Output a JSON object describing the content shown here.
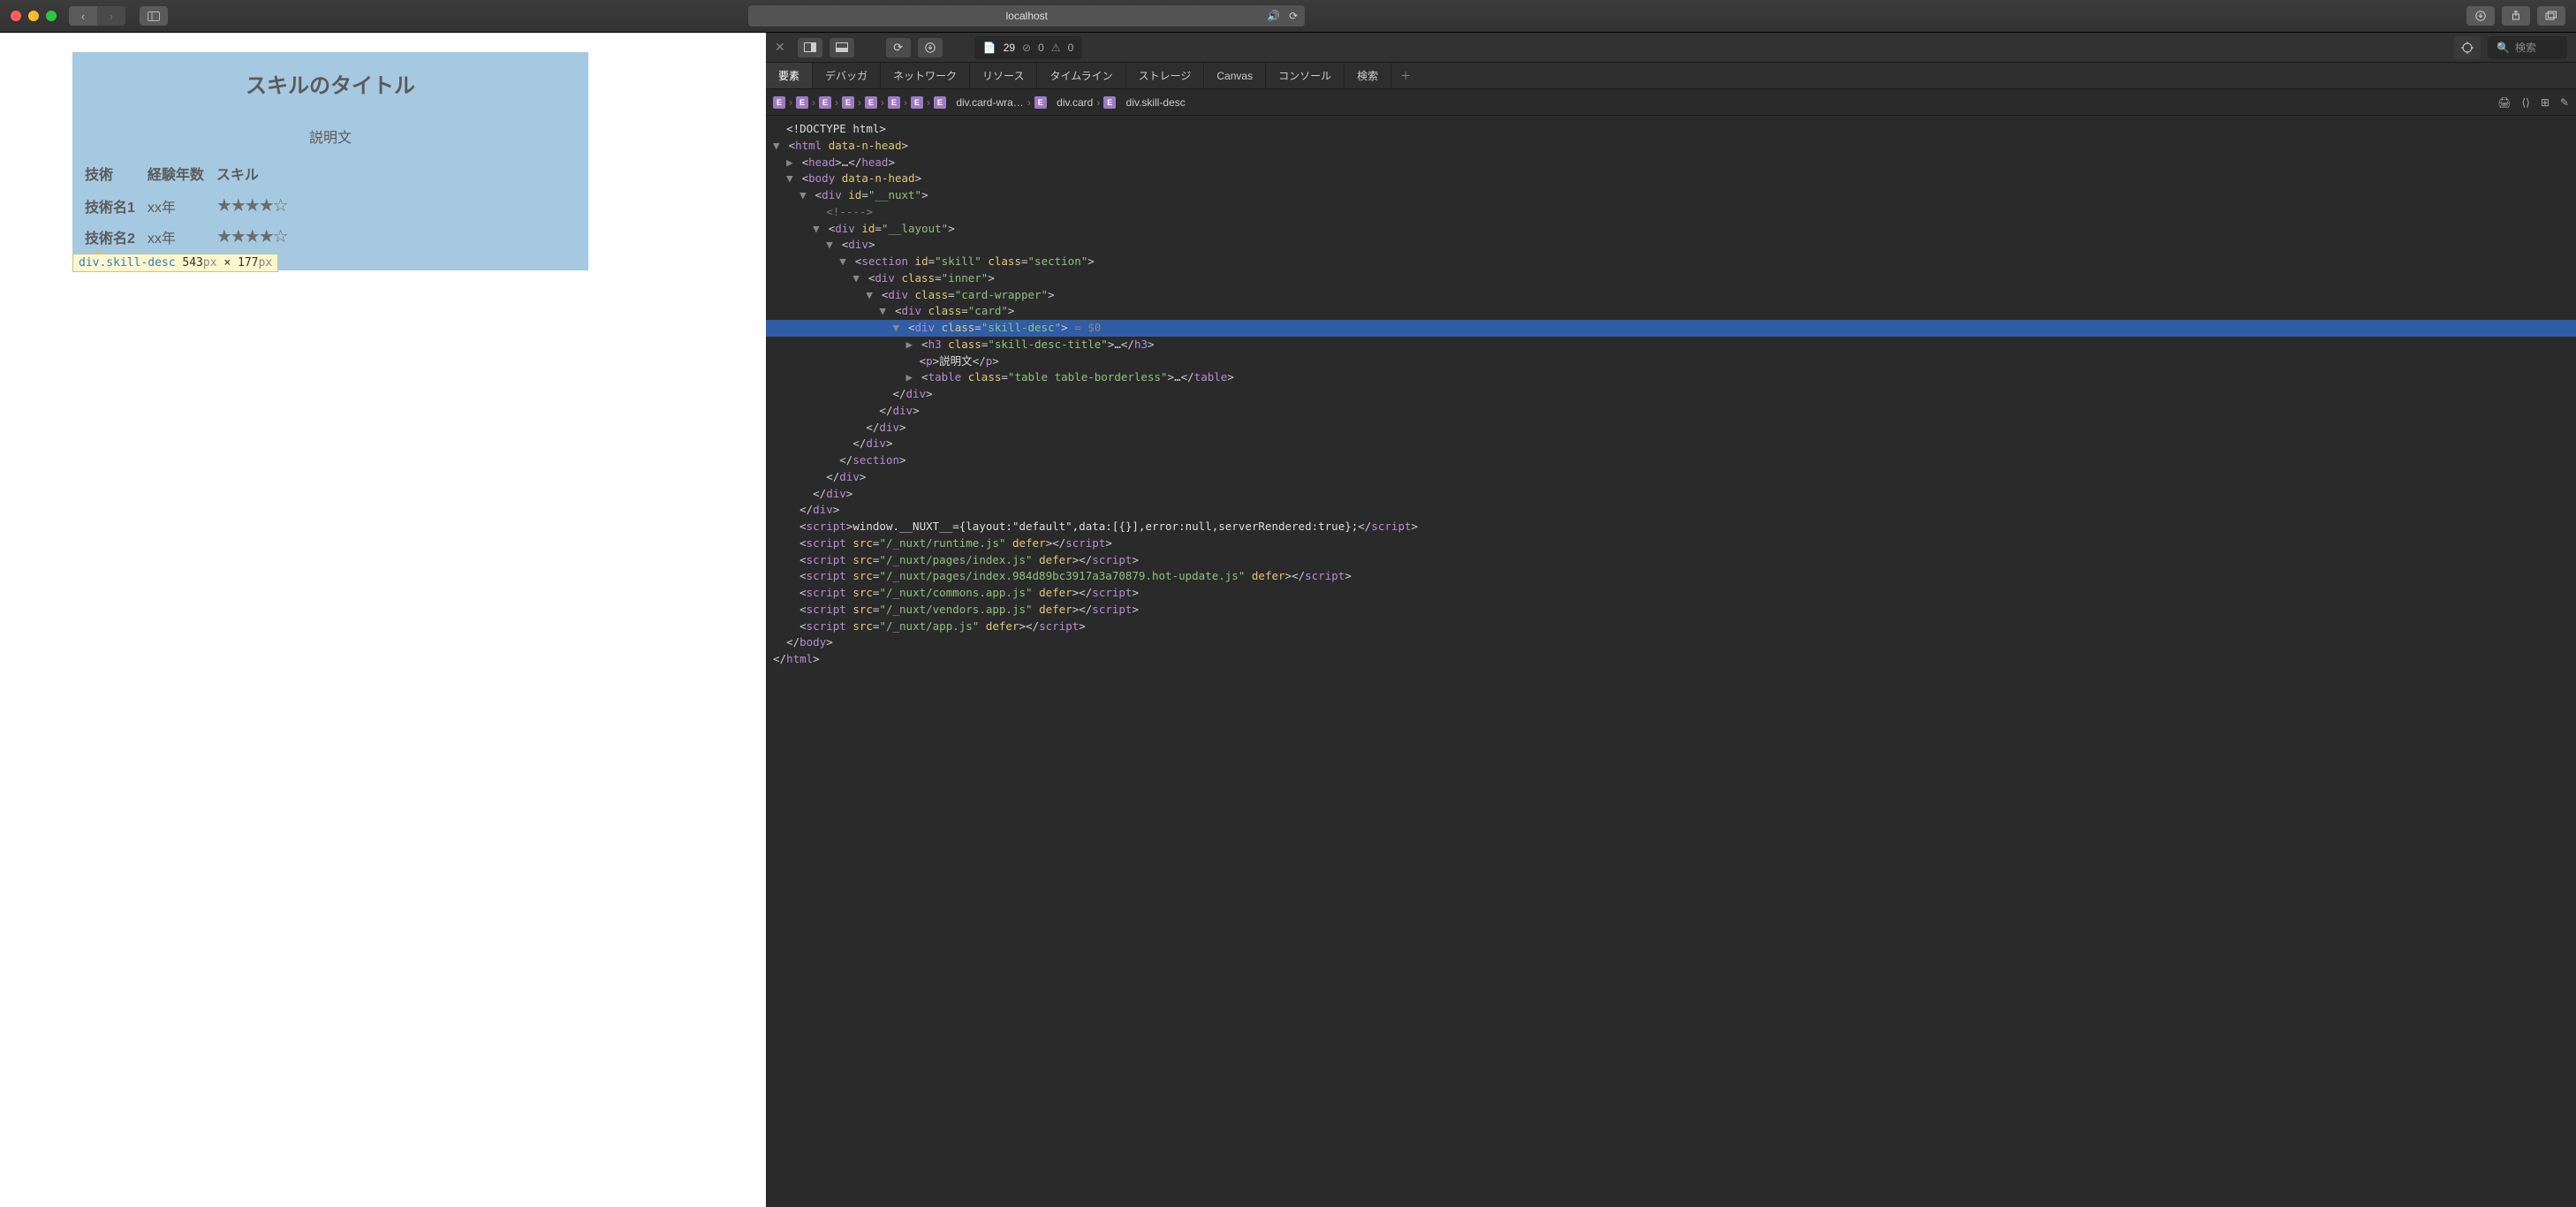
{
  "titlebar": {
    "url": "localhost"
  },
  "page": {
    "skill_title": "スキルのタイトル",
    "skill_desc": "説明文",
    "table": {
      "head": {
        "tech": "技術",
        "years": "経験年数",
        "skill": "スキル"
      },
      "rows": [
        {
          "tech": "技術名1",
          "years": "xx年",
          "stars": "★★★★☆"
        },
        {
          "tech": "技術名2",
          "years": "xx年",
          "stars": "★★★★☆"
        }
      ]
    },
    "inspect_tooltip": {
      "selector": "div.skill-desc",
      "w": "543",
      "h": "177",
      "unit": "px",
      "times": " × "
    }
  },
  "devtools": {
    "toolbar": {
      "resources_count": "29",
      "circle_count": "0",
      "warn_count": "0",
      "search_placeholder": "検索"
    },
    "tabs": [
      "要素",
      "デバッガ",
      "ネットワーク",
      "リソース",
      "タイムライン",
      "ストレージ",
      "Canvas",
      "コンソール",
      "検索"
    ],
    "breadcrumb_tail": [
      "div.card-wra…",
      "div.card",
      "div.skill-desc"
    ],
    "tree": {
      "doctype": "<!DOCTYPE html>",
      "html_attr": "data-n-head",
      "body_attr": "data-n-head",
      "section_id": "skill",
      "section_class": "section",
      "inner_class": "inner",
      "cardw_class": "card-wrapper",
      "card_class": "card",
      "skilldesc_class": "skill-desc",
      "title_class": "skill-desc-title",
      "p_text": "説明文",
      "table_class": "table table-borderless",
      "nuxt_script": "window.__NUXT__={layout:\"default\",data:[{}],error:null,serverRendered:true};",
      "scripts": [
        {
          "src": "/_nuxt/runtime.js",
          "defer": true
        },
        {
          "src": "/_nuxt/pages/index.js",
          "defer": true
        },
        {
          "src": "/_nuxt/pages/index.984d89bc3917a3a70879.hot-update.js",
          "defer": true
        },
        {
          "src": "/_nuxt/commons.app.js",
          "defer": true
        },
        {
          "src": "/_nuxt/vendors.app.js",
          "defer": true
        },
        {
          "src": "/_nuxt/app.js",
          "defer": true
        }
      ]
    }
  }
}
